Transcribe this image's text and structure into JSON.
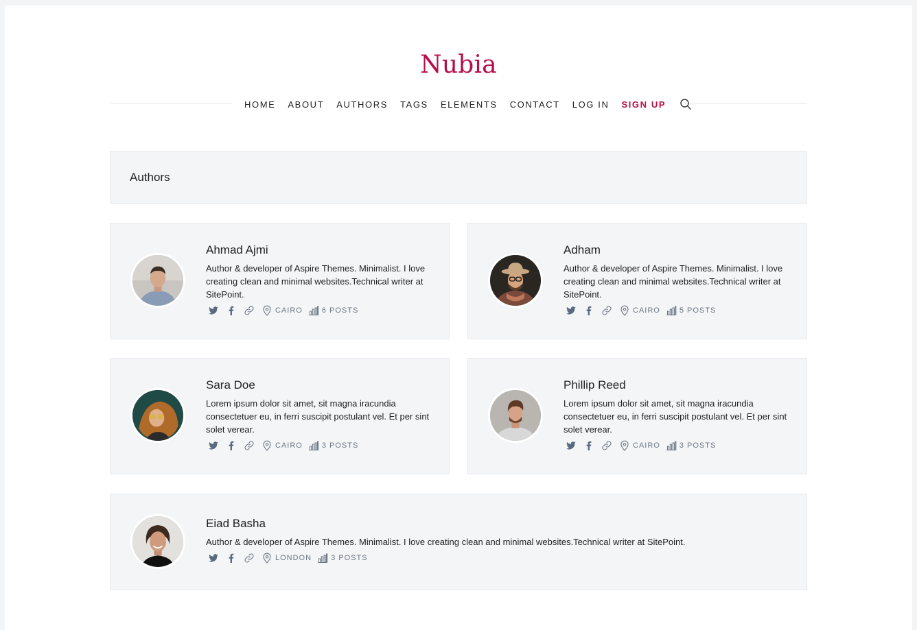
{
  "brand": {
    "title": "Nubia",
    "color": "#b80d4a"
  },
  "nav": {
    "items": [
      "HOME",
      "ABOUT",
      "AUTHORS",
      "TAGS",
      "ELEMENTS",
      "CONTACT",
      "LOG IN",
      "SIGN UP"
    ],
    "search_icon": "search-icon"
  },
  "page_header": {
    "title": "Authors"
  },
  "authors": [
    {
      "name": "Ahmad Ajmi",
      "bio": "Author & developer of Aspire Themes. Minimalist. I love creating clean and minimal websites.Technical writer at SitePoint.",
      "location": "CAIRO",
      "posts": "6 POSTS"
    },
    {
      "name": "Adham",
      "bio": "Author & developer of Aspire Themes. Minimalist. I love creating clean and minimal websites.Technical writer at SitePoint.",
      "location": "CAIRO",
      "posts": "5 POSTS"
    },
    {
      "name": "Sara Doe",
      "bio": "Lorem ipsum dolor sit amet, sit magna iracundia consectetuer eu, in ferri suscipit postulant vel. Et per sint solet verear.",
      "location": "CAIRO",
      "posts": "3 POSTS"
    },
    {
      "name": "Phillip Reed",
      "bio": "Lorem ipsum dolor sit amet, sit magna iracundia consectetuer eu, in ferri suscipit postulant vel. Et per sint solet verear.",
      "location": "CAIRO",
      "posts": "3 POSTS"
    },
    {
      "name": "Eiad Basha",
      "bio": "Author & developer of Aspire Themes. Minimalist. I love creating clean and minimal websites.Technical writer at SitePoint.",
      "location": "LONDON",
      "posts": "3 POSTS"
    }
  ],
  "icons": [
    "twitter-icon",
    "facebook-icon",
    "link-icon",
    "location-pin-icon",
    "bar-chart-icon"
  ],
  "colors": {
    "accent": "#b80d4a",
    "card_bg": "#f4f5f7",
    "meta_text": "#6a7684"
  }
}
